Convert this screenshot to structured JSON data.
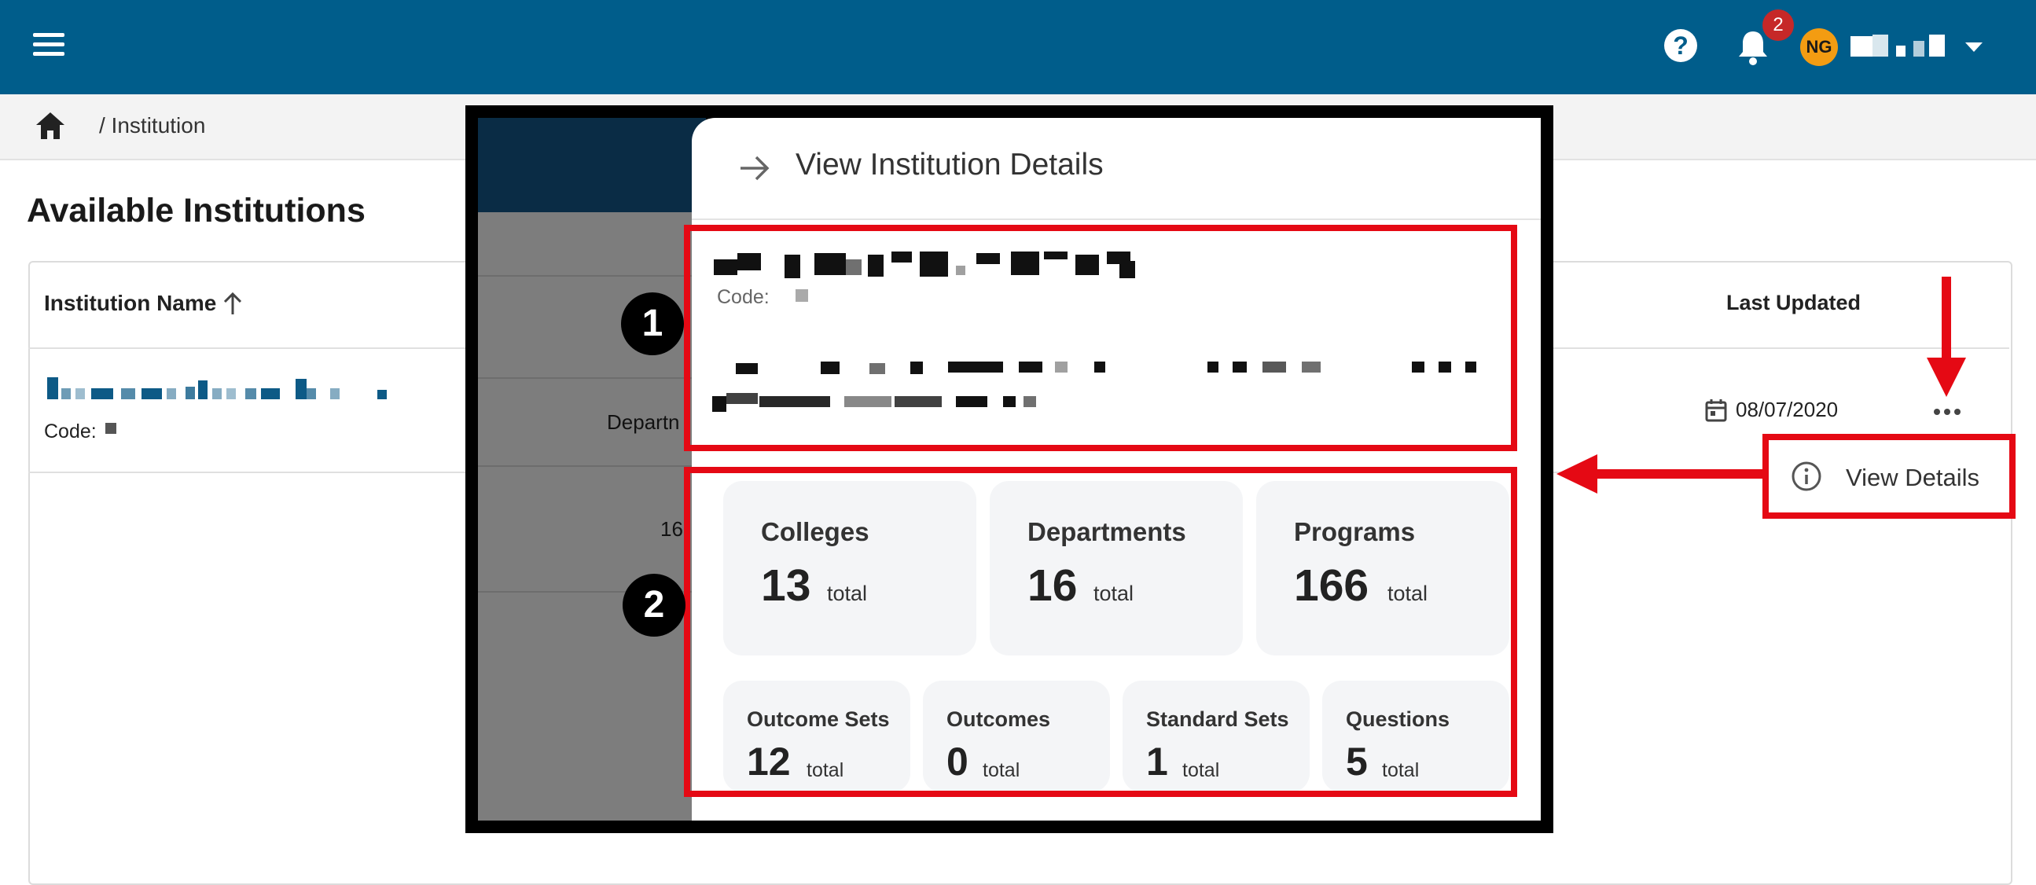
{
  "header": {
    "help_icon_label": "?",
    "notification_count": "2",
    "avatar_initials": "NG"
  },
  "breadcrumb": {
    "current": "/ Institution"
  },
  "page": {
    "title": "Available Institutions"
  },
  "table": {
    "col_name": "Institution Name",
    "col_updated": "Last Updated",
    "row": {
      "code_label": "Code:",
      "last_updated": "08/07/2020"
    }
  },
  "context_menu": {
    "view_details_label": "View Details"
  },
  "panel": {
    "title": "View Institution Details",
    "code_label": "Code:",
    "background_partial_1": "Departn",
    "background_partial_2": "16",
    "stats_primary": [
      {
        "label": "Colleges",
        "value": "13",
        "unit": "total"
      },
      {
        "label": "Departments",
        "value": "16",
        "unit": "total"
      },
      {
        "label": "Programs",
        "value": "166",
        "unit": "total"
      }
    ],
    "stats_secondary": [
      {
        "label": "Outcome Sets",
        "value": "12",
        "unit": "total"
      },
      {
        "label": "Outcomes",
        "value": "0",
        "unit": "total"
      },
      {
        "label": "Standard Sets",
        "value": "1",
        "unit": "total"
      },
      {
        "label": "Questions",
        "value": "5",
        "unit": "total"
      }
    ]
  },
  "callouts": {
    "step1": "1",
    "step2": "2"
  },
  "colors": {
    "topbar": "#005d8b",
    "highlight": "#e50914",
    "badge": "#c62828",
    "avatar": "#f39c12"
  },
  "icons": [
    "menu-icon",
    "help-icon",
    "bell-icon",
    "caret-down-icon",
    "home-icon",
    "sort-up-icon",
    "calendar-icon",
    "more-icon",
    "info-icon",
    "arrow-right-icon"
  ]
}
